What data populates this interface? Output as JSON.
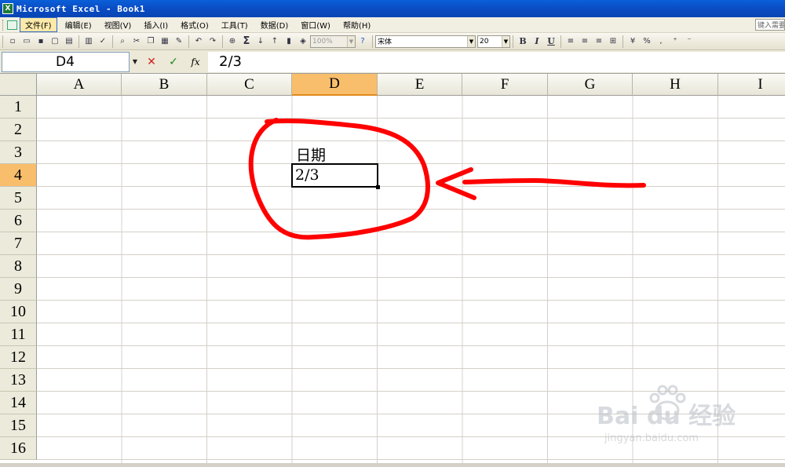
{
  "window": {
    "app_icon": "X",
    "title": "Microsoft Excel - Book1"
  },
  "menu": {
    "items": [
      "文件(F)",
      "编辑(E)",
      "视图(V)",
      "插入(I)",
      "格式(O)",
      "工具(T)",
      "数据(D)",
      "窗口(W)",
      "帮助(H)"
    ],
    "help_placeholder": "键入需要"
  },
  "toolbar": {
    "zoom": "100%",
    "font_name": "宋体",
    "font_size": "20",
    "bold": "B",
    "italic": "I",
    "underline": "U",
    "icons": [
      "new-icon",
      "open-icon",
      "save-icon",
      "permission-icon",
      "print-icon",
      "print-preview-icon",
      "spelling-icon",
      "research-icon",
      "cut-icon",
      "copy-icon",
      "paste-icon",
      "format-painter-icon",
      "undo-icon",
      "redo-icon",
      "hyperlink-icon",
      "autosum-icon",
      "sort-ascending-icon",
      "sort-descending-icon",
      "chart-wizard-icon",
      "drawing-icon",
      "help-icon"
    ]
  },
  "formula_bar": {
    "name_box": "D4",
    "cancel": "✕",
    "enter": "✓",
    "fx": "fx",
    "content": "2/3"
  },
  "sheet": {
    "columns": [
      "A",
      "B",
      "C",
      "D",
      "E",
      "F",
      "G",
      "H",
      "I"
    ],
    "rows": [
      "1",
      "2",
      "3",
      "4",
      "5",
      "6",
      "7",
      "8",
      "9",
      "10",
      "11",
      "12",
      "13",
      "14",
      "15",
      "16"
    ],
    "active_cell": "D4",
    "cells": {
      "D3": "日期",
      "D4": "2/3"
    }
  },
  "watermark": {
    "brand": "Bai du 经验",
    "url": "jingyan.baidu.com"
  },
  "annotation": {
    "color": "#ff0000",
    "shapes": [
      "circle-around-D3-D4",
      "arrow-pointing-left"
    ]
  }
}
